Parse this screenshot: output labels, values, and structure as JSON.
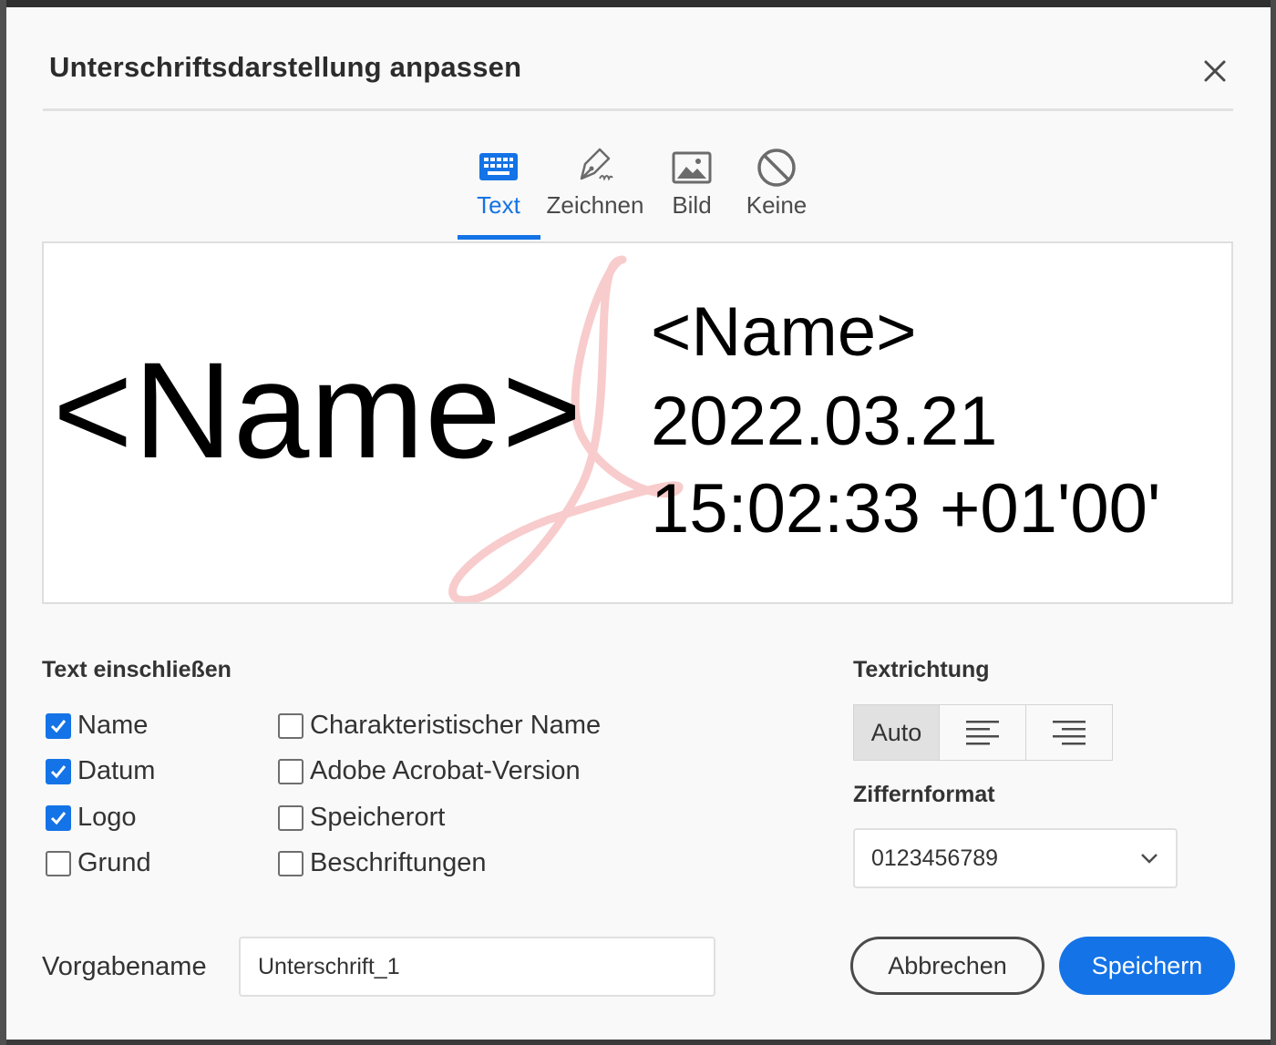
{
  "dialog": {
    "title": "Unterschriftsdarstellung anpassen"
  },
  "tabs": [
    {
      "label": "Text",
      "icon": "keyboard-icon",
      "active": true
    },
    {
      "label": "Zeichnen",
      "icon": "pen-icon",
      "active": false
    },
    {
      "label": "Bild",
      "icon": "image-icon",
      "active": false
    },
    {
      "label": "Keine",
      "icon": "none-icon",
      "active": false
    }
  ],
  "preview": {
    "name": "<Name>",
    "detail_name": "<Name>",
    "date": "2022.03.21",
    "time": "15:02:33 +01'00'"
  },
  "include_text": {
    "heading": "Text einschließen",
    "left": [
      {
        "label": "Name",
        "checked": true
      },
      {
        "label": "Datum",
        "checked": true
      },
      {
        "label": "Logo",
        "checked": true
      },
      {
        "label": "Grund",
        "checked": false
      }
    ],
    "right": [
      {
        "label": "Charakteristischer Name",
        "checked": false
      },
      {
        "label": "Adobe Acrobat-Version",
        "checked": false
      },
      {
        "label": "Speicherort",
        "checked": false
      },
      {
        "label": "Beschriftungen",
        "checked": false
      }
    ]
  },
  "text_direction": {
    "heading": "Textrichtung",
    "auto_label": "Auto",
    "selected": "Auto"
  },
  "digit_format": {
    "heading": "Ziffernformat",
    "value": "0123456789"
  },
  "preset": {
    "label": "Vorgabename",
    "value": "Unterschrift_1"
  },
  "buttons": {
    "cancel": "Abbrechen",
    "save": "Speichern"
  },
  "colors": {
    "accent": "#1473e6",
    "logo": "#f7c6c6"
  }
}
